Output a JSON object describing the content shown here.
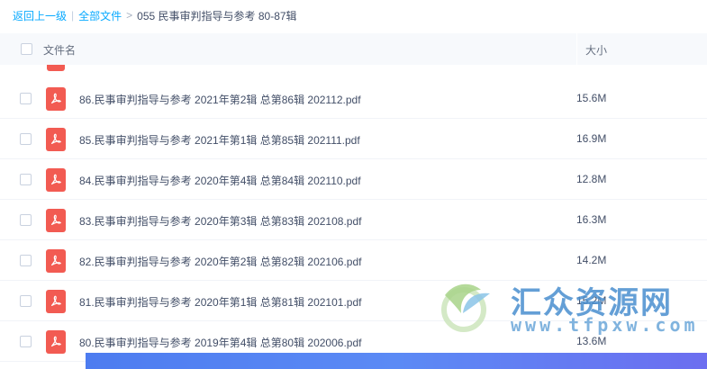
{
  "breadcrumb": {
    "back": "返回上一级",
    "separator": "|",
    "all_files": "全部文件",
    "arrow": ">",
    "current": "055 民事审判指导与参考 80-87辑"
  },
  "table_header": {
    "name": "文件名",
    "size": "大小"
  },
  "files": [
    {
      "name": "86.民事审判指导与参考 2021年第2辑 总第86辑 202112.pdf",
      "size": "15.6M",
      "icon": "pdf-icon"
    },
    {
      "name": "85.民事审判指导与参考 2021年第1辑 总第85辑 202111.pdf",
      "size": "16.9M",
      "icon": "pdf-icon"
    },
    {
      "name": "84.民事审判指导与参考 2020年第4辑 总第84辑 202110.pdf",
      "size": "12.8M",
      "icon": "pdf-icon"
    },
    {
      "name": "83.民事审判指导与参考 2020年第3辑 总第83辑 202108.pdf",
      "size": "16.3M",
      "icon": "pdf-icon"
    },
    {
      "name": "82.民事审判指导与参考 2020年第2辑 总第82辑 202106.pdf",
      "size": "14.2M",
      "icon": "pdf-icon"
    },
    {
      "name": "81.民事审判指导与参考 2020年第1辑 总第81辑 202101.pdf",
      "size": "15.2M",
      "icon": "pdf-icon"
    },
    {
      "name": "80.民事审判指导与参考 2019年第4辑 总第80辑 202006.pdf",
      "size": "13.6M",
      "icon": "pdf-icon"
    }
  ],
  "watermark": {
    "title": "汇众资源网",
    "url": "www.tfpxw.com"
  },
  "colors": {
    "link": "#09aaff",
    "pdf": "#f25b52",
    "header_bg": "#f7f9fc"
  }
}
